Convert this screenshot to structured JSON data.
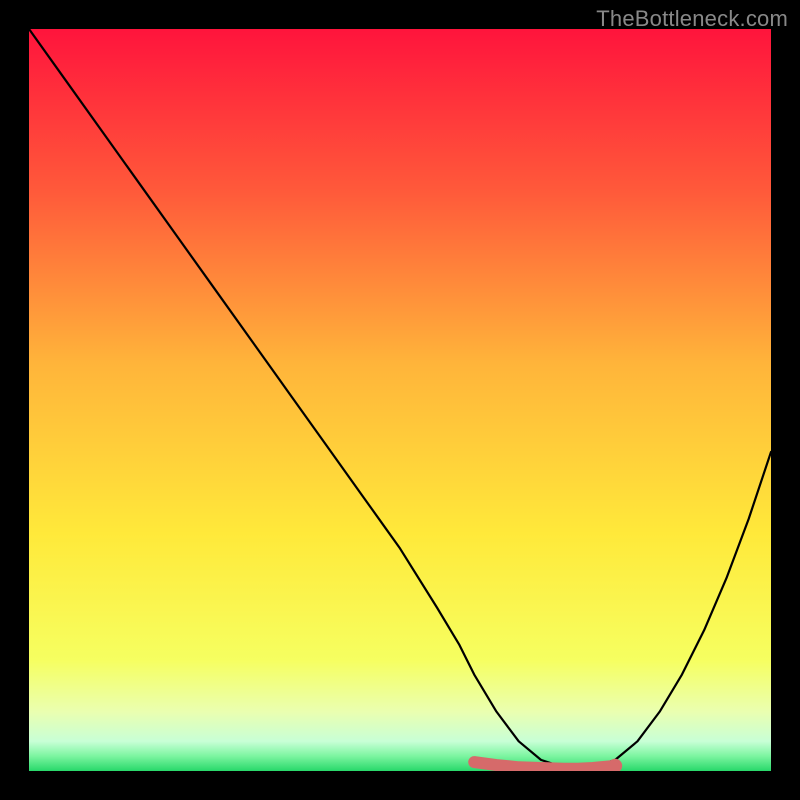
{
  "watermark": "TheBottleneck.com",
  "chart_data": {
    "type": "line",
    "title": "",
    "xlabel": "",
    "ylabel": "",
    "xlim": [
      0,
      100
    ],
    "ylim": [
      0,
      100
    ],
    "grid": false,
    "legend": false,
    "series": [
      {
        "name": "bottleneck-curve",
        "x": [
          0,
          5,
          10,
          15,
          20,
          25,
          30,
          35,
          40,
          45,
          50,
          55,
          58,
          60,
          63,
          66,
          69,
          72,
          74,
          76,
          79,
          82,
          85,
          88,
          91,
          94,
          97,
          100
        ],
        "y": [
          100,
          93,
          86,
          79,
          72,
          65,
          58,
          51,
          44,
          37,
          30,
          22,
          17,
          13,
          8,
          4,
          1.5,
          0.5,
          0.3,
          0.5,
          1.5,
          4,
          8,
          13,
          19,
          26,
          34,
          43
        ]
      }
    ],
    "highlight_segment": {
      "name": "green-band-overlay",
      "x": [
        60,
        63,
        66,
        69,
        72,
        74,
        76,
        79
      ],
      "y": [
        1.2,
        0.8,
        0.5,
        0.4,
        0.3,
        0.3,
        0.4,
        0.7
      ]
    },
    "gradient_stops": [
      {
        "pct": 0,
        "color": "#ff143c"
      },
      {
        "pct": 22,
        "color": "#ff5a3a"
      },
      {
        "pct": 45,
        "color": "#ffb43a"
      },
      {
        "pct": 68,
        "color": "#ffe93a"
      },
      {
        "pct": 85,
        "color": "#f6ff60"
      },
      {
        "pct": 92,
        "color": "#eaffb0"
      },
      {
        "pct": 96,
        "color": "#c8ffd6"
      },
      {
        "pct": 98,
        "color": "#7cf5a0"
      },
      {
        "pct": 100,
        "color": "#28d86a"
      }
    ]
  }
}
